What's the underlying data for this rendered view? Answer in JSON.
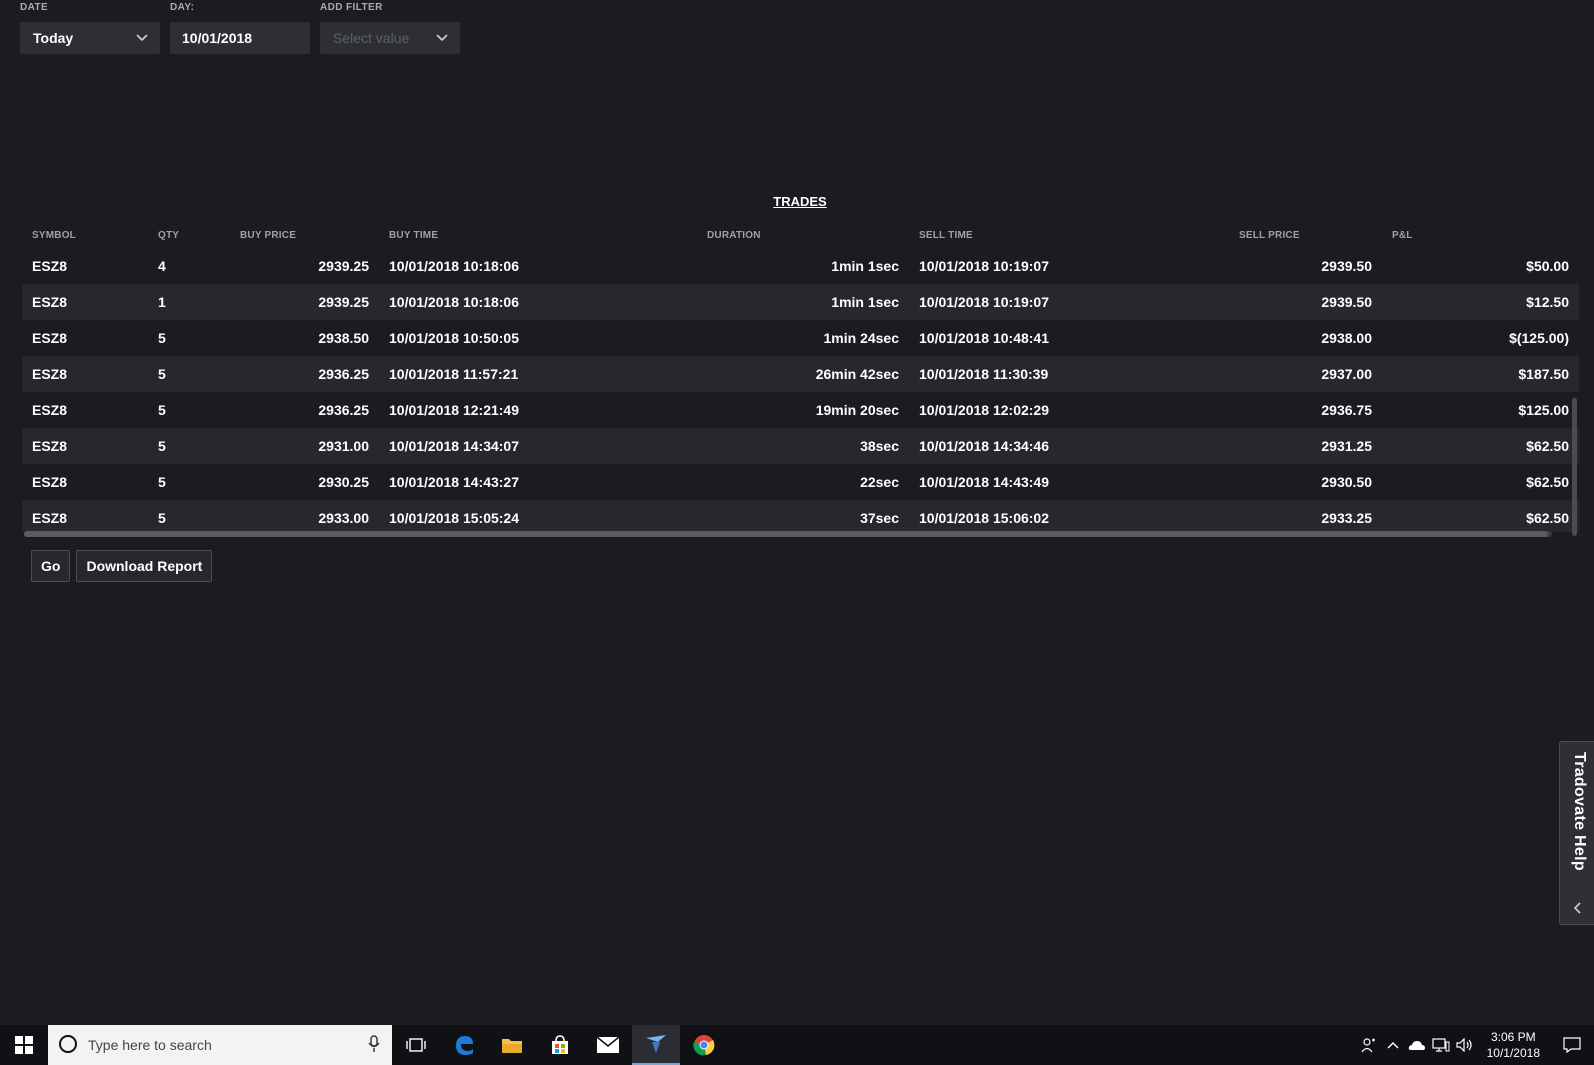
{
  "filters": {
    "date": {
      "label": "DATE",
      "value": "Today"
    },
    "day": {
      "label": "DAY:",
      "value": "10/01/2018"
    },
    "add_filter": {
      "label": "ADD FILTER",
      "placeholder": "Select value"
    }
  },
  "trades": {
    "title": "TRADES",
    "columns": [
      "SYMBOL",
      "QTY",
      "BUY PRICE",
      "BUY TIME",
      "DURATION",
      "SELL TIME",
      "SELL PRICE",
      "P&L"
    ],
    "rows": [
      {
        "symbol": "ESZ8",
        "qty": "4",
        "buy_price": "2939.25",
        "buy_time": "10/01/2018 10:18:06",
        "duration": "1min 1sec",
        "sell_time": "10/01/2018 10:19:07",
        "sell_price": "2939.50",
        "pnl": "$50.00"
      },
      {
        "symbol": "ESZ8",
        "qty": "1",
        "buy_price": "2939.25",
        "buy_time": "10/01/2018 10:18:06",
        "duration": "1min 1sec",
        "sell_time": "10/01/2018 10:19:07",
        "sell_price": "2939.50",
        "pnl": "$12.50"
      },
      {
        "symbol": "ESZ8",
        "qty": "5",
        "buy_price": "2938.50",
        "buy_time": "10/01/2018 10:50:05",
        "duration": "1min 24sec",
        "sell_time": "10/01/2018 10:48:41",
        "sell_price": "2938.00",
        "pnl": "$(125.00)"
      },
      {
        "symbol": "ESZ8",
        "qty": "5",
        "buy_price": "2936.25",
        "buy_time": "10/01/2018 11:57:21",
        "duration": "26min 42sec",
        "sell_time": "10/01/2018 11:30:39",
        "sell_price": "2937.00",
        "pnl": "$187.50"
      },
      {
        "symbol": "ESZ8",
        "qty": "5",
        "buy_price": "2936.25",
        "buy_time": "10/01/2018 12:21:49",
        "duration": "19min 20sec",
        "sell_time": "10/01/2018 12:02:29",
        "sell_price": "2936.75",
        "pnl": "$125.00"
      },
      {
        "symbol": "ESZ8",
        "qty": "5",
        "buy_price": "2931.00",
        "buy_time": "10/01/2018 14:34:07",
        "duration": "38sec",
        "sell_time": "10/01/2018 14:34:46",
        "sell_price": "2931.25",
        "pnl": "$62.50"
      },
      {
        "symbol": "ESZ8",
        "qty": "5",
        "buy_price": "2930.25",
        "buy_time": "10/01/2018 14:43:27",
        "duration": "22sec",
        "sell_time": "10/01/2018 14:43:49",
        "sell_price": "2930.50",
        "pnl": "$62.50"
      },
      {
        "symbol": "ESZ8",
        "qty": "5",
        "buy_price": "2933.00",
        "buy_time": "10/01/2018 15:05:24",
        "duration": "37sec",
        "sell_time": "10/01/2018 15:06:02",
        "sell_price": "2933.25",
        "pnl": "$62.50"
      }
    ]
  },
  "actions": {
    "go_label": "Go",
    "download_label": "Download Report"
  },
  "help_tab": {
    "label": "Tradovate Help"
  },
  "taskbar": {
    "search_placeholder": "Type here to search",
    "time": "3:06 PM",
    "date": "10/1/2018"
  },
  "icons": [
    "chevron-down-icon",
    "windows-start-icon",
    "cortana-icon",
    "microphone-icon",
    "task-view-icon",
    "edge-icon",
    "file-explorer-icon",
    "store-icon",
    "mail-icon",
    "tradovate-icon",
    "chrome-icon",
    "people-icon",
    "chevron-up-icon",
    "onedrive-icon",
    "network-icon",
    "volume-icon",
    "notification-icon",
    "chevron-left-icon"
  ]
}
